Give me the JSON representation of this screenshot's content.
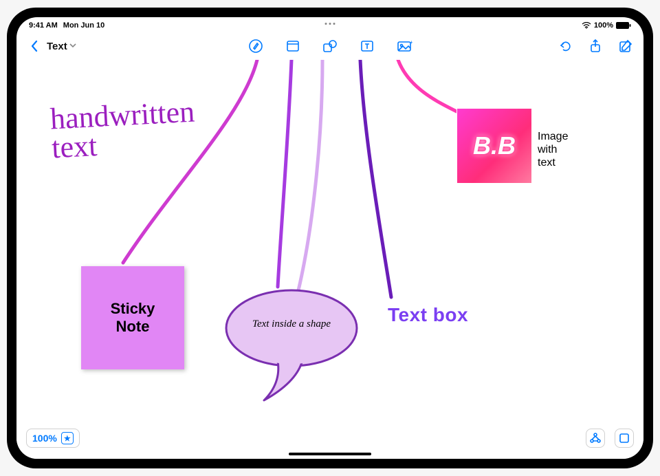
{
  "status": {
    "time": "9:41 AM",
    "date": "Mon Jun 10",
    "battery_pct": "100%"
  },
  "toolbar": {
    "board_title": "Text"
  },
  "canvas": {
    "handwritten_text": "handwritten\n   text",
    "sticky_note_text": "Sticky\nNote",
    "shape_text": "Text inside a shape",
    "textbox_text": "Text box",
    "image_thumb_text": "B.B",
    "image_label": "Image\nwith\ntext"
  },
  "bottom": {
    "zoom_level": "100%"
  }
}
